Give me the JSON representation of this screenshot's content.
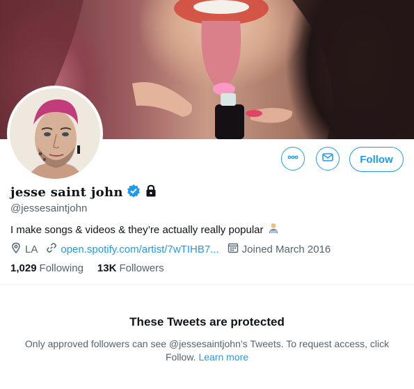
{
  "profile": {
    "display_name": "jesse saint john",
    "handle": "@jessesaintjohn",
    "bio": "I make songs & videos & they’re actually really popular",
    "bio_emoji": "man-technologist-emoji",
    "location": "LA",
    "website": "open.spotify.com/artist/7wTIHB7...",
    "joined": "Joined March 2016",
    "following_count": "1,029",
    "following_label": "Following",
    "followers_count": "13K",
    "followers_label": "Followers"
  },
  "actions": {
    "follow_label": "Follow",
    "more_icon": "more-icon",
    "message_icon": "message-icon"
  },
  "protected": {
    "title": "These Tweets are protected",
    "message": "Only approved followers can see @jessesaintjohn’s Tweets. To request access, click Follow.",
    "learn_more": "Learn more"
  },
  "colors": {
    "accent": "#1d9bf0",
    "text_primary": "#0f1419",
    "text_secondary": "#536471"
  }
}
